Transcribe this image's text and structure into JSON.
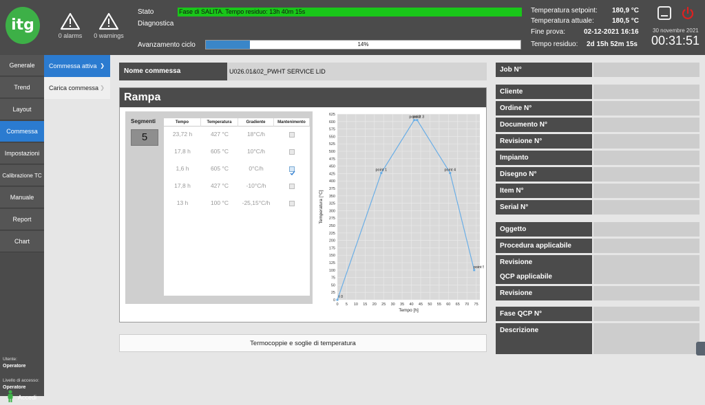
{
  "header": {
    "logo_text": "itg",
    "alarms_label": "0 alarms",
    "warnings_label": "0 warnings",
    "stato_label": "Stato",
    "stato_value": "Fase di SALITA. Tempo residuo: 13h 40m 15s",
    "diagnostica_label": "Diagnostica",
    "avanzamento_label": "Avanzamento ciclo",
    "avanzamento_value": "14%",
    "avanzamento_percent": 14,
    "setpoint_label": "Temperatura setpoint:",
    "setpoint_value": "180,9 °C",
    "attuale_label": "Temperatura attuale:",
    "attuale_value": "180,5 °C",
    "fine_label": "Fine prova:",
    "fine_value": "02-12-2021 16:16",
    "residuo_label": "Tempo residuo:",
    "residuo_value": "2d 15h 52m 15s",
    "date": "30 novembre 2021",
    "time": "00:31:51",
    "status_color": "#19c619",
    "accent_color": "#2b7bd0"
  },
  "sidebar": {
    "items": [
      "Generale",
      "Trend",
      "Layout",
      "Commessa",
      "Impostazioni",
      "Calibrazione TC",
      "Manuale",
      "Report",
      "Chart"
    ],
    "active": "Commessa",
    "accedi": "Accedi",
    "utente_label": "Utente:",
    "utente_value": "Operatore",
    "livello_label": "Livello di accesso:",
    "livello_value": "Operatore"
  },
  "submenu": {
    "items": [
      "Commessa attiva",
      "Carica commessa"
    ],
    "active_arrow": "❯",
    "inactive_arrow": "❯"
  },
  "commessa": {
    "nome_label": "Nome commessa",
    "nome_value": "U026.01&02_PWHT SERVICE LID",
    "rampa_title": "Rampa",
    "segmenti_label": "Segmenti",
    "segmenti_value": "5",
    "table_headers": [
      "Tempo",
      "Temperatura",
      "Gradiente",
      "Mantenimento"
    ],
    "table_rows": [
      {
        "tempo": "23,72 h",
        "temperatura": "427 °C",
        "gradiente": "18°C/h",
        "mantenimento": false
      },
      {
        "tempo": "17,8 h",
        "temperatura": "605 °C",
        "gradiente": "10°C/h",
        "mantenimento": false
      },
      {
        "tempo": "1,6 h",
        "temperatura": "605 °C",
        "gradiente": "0°C/h",
        "mantenimento": true
      },
      {
        "tempo": "17,8 h",
        "temperatura": "427 °C",
        "gradiente": "-10°C/h",
        "mantenimento": false
      },
      {
        "tempo": "13 h",
        "temperatura": "100 °C",
        "gradiente": "-25,15°C/h",
        "mantenimento": false
      }
    ],
    "termocoppie_button": "Termocoppie e soglie di temperatura"
  },
  "chart_data": {
    "type": "line",
    "xlabel": "Tempo [h]",
    "ylabel": "Temperatura [°C]",
    "xlim": [
      0,
      77
    ],
    "ylim": [
      0,
      625
    ],
    "xticks": [
      0,
      5,
      10,
      15,
      20,
      25,
      30,
      35,
      40,
      45,
      50,
      55,
      60,
      65,
      70,
      75
    ],
    "yticks": [
      0,
      25,
      50,
      75,
      100,
      125,
      150,
      175,
      200,
      225,
      250,
      275,
      300,
      325,
      350,
      375,
      400,
      425,
      450,
      475,
      500,
      525,
      550,
      575,
      600,
      625
    ],
    "grid": true,
    "line_color": "#6aaee6",
    "points": [
      {
        "label": "t 0",
        "x": 0,
        "y": 0
      },
      {
        "label": "point 1",
        "x": 23.72,
        "y": 427
      },
      {
        "label": "point 2",
        "x": 41.52,
        "y": 605
      },
      {
        "label": "point 3",
        "x": 43.12,
        "y": 605
      },
      {
        "label": "point 4",
        "x": 60.92,
        "y": 427
      },
      {
        "label": "point 5",
        "x": 73.92,
        "y": 100
      }
    ]
  },
  "job_fields": {
    "group1": [
      "Job N°"
    ],
    "group2": [
      "Cliente",
      "Ordine N°",
      "Documento N°",
      "Revisione N°",
      "Impianto",
      "Disegno N°",
      "Item N°",
      "Serial N°"
    ],
    "group3": [
      "Oggetto"
    ],
    "group4": [
      "Procedura applicabile",
      "Revisione"
    ],
    "group5": [
      "QCP applicabile",
      "Revisione"
    ],
    "group6": [
      "Fase QCP N°",
      "Descrizione"
    ]
  }
}
